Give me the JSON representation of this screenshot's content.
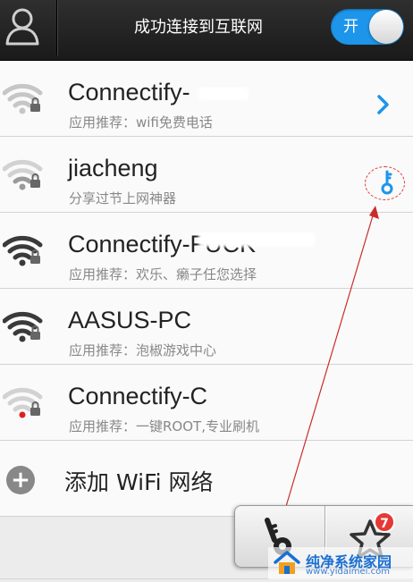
{
  "header": {
    "title": "成功连接到互联网",
    "toggle_label": "开"
  },
  "networks": [
    {
      "name": "Connectify-",
      "subtitle": "应用推荐：wifi免费电话",
      "action": "chevron-right-icon",
      "signal": "full"
    },
    {
      "name": "jiacheng",
      "subtitle": "分享过节上网神器",
      "action": "key-icon",
      "signal": "weak"
    },
    {
      "name": "Connectify-FUCK",
      "subtitle": "应用推荐：欢乐、癞子任您选择",
      "action": "",
      "signal": "full"
    },
    {
      "name": "AASUS-PC",
      "subtitle": "应用推荐：泡椒游戏中心",
      "action": "",
      "signal": "full"
    },
    {
      "name": "Connectify-C",
      "subtitle": "应用推荐：一键ROOT,专业刷机",
      "action": "",
      "signal": "none"
    }
  ],
  "add_network": {
    "label": "添加 WiFi 网络"
  },
  "dock": {
    "badge_count": "7"
  },
  "watermark": {
    "title": "纯净系统家园",
    "url": "www.yidaimei.com"
  },
  "colors": {
    "accent": "#1d95ea",
    "header_bg": "#222222",
    "badge": "#e53935",
    "annotation": "#dd3333"
  }
}
